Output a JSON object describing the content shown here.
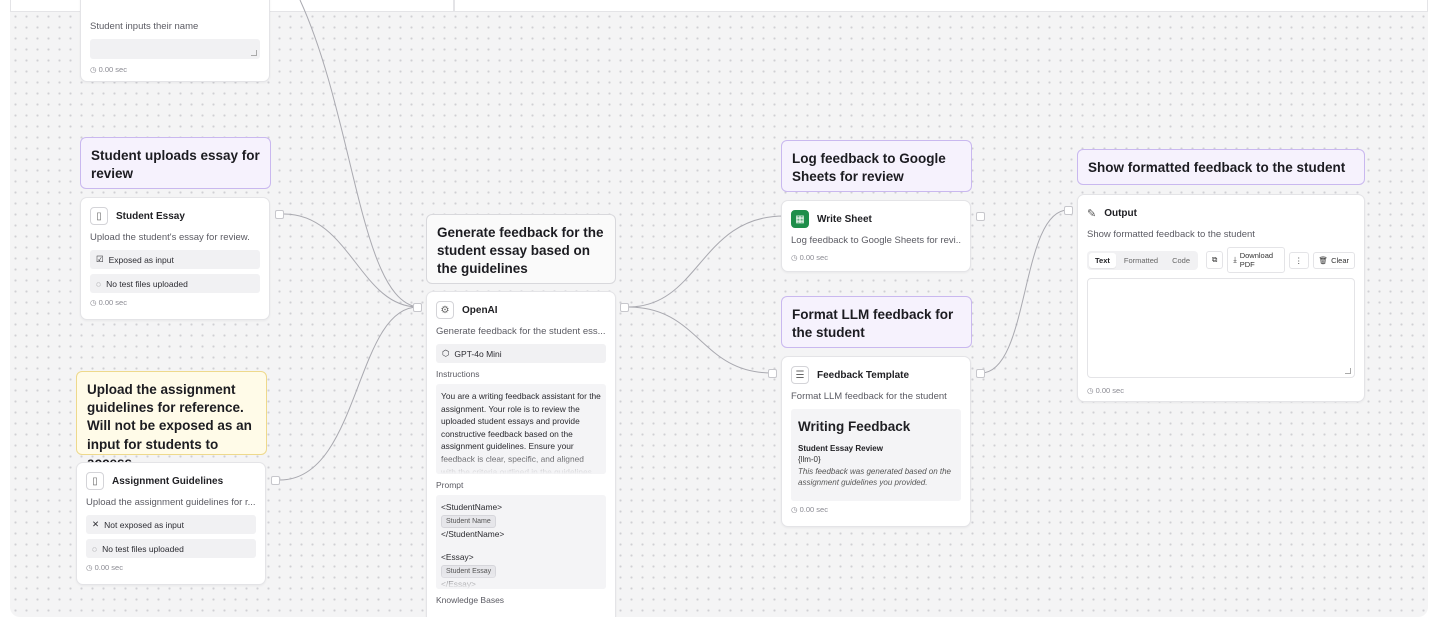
{
  "nodes": {
    "student_name": {
      "desc": "Student inputs their name",
      "time": "◷ 0.00 sec"
    },
    "student_essay": {
      "note": "Student uploads essay for review",
      "title": "Student Essay",
      "desc": "Upload the student's essay for review.",
      "exposed": "Exposed as input",
      "files": "No test files uploaded",
      "time": "◷ 0.00 sec"
    },
    "guidelines": {
      "note": "Upload the assignment guidelines for reference. Will not be exposed as an input for students to access",
      "title": "Assignment Guidelines",
      "desc": "Upload the assignment guidelines for r...",
      "exposed": "Not exposed as input",
      "files": "No test files uploaded",
      "time": "◷ 0.00 sec"
    },
    "openai": {
      "note": "Generate feedback for the student essay based on the guidelines",
      "title": "OpenAI",
      "desc": "Generate feedback for the student ess...",
      "model": "GPT-4o Mini",
      "instructions_label": "Instructions",
      "instructions": "You are a writing feedback assistant for the assignment. Your role is to review the uploaded student essays and provide constructive feedback based on the assignment guidelines. Ensure your feedback is clear, specific, and aligned with the criteria outlined in the guidelines.",
      "prompt_label": "Prompt",
      "prompt_name_open": "<StudentName>",
      "prompt_name_chip": "Student Name",
      "prompt_name_close": "</StudentName>",
      "prompt_essay_open": "<Essay>",
      "prompt_essay_chip": "Student Essay",
      "prompt_essay_close": "</Essay>",
      "kb_label": "Knowledge Bases"
    },
    "write_sheet": {
      "note": "Log feedback to Google Sheets for review",
      "title": "Write Sheet",
      "desc": "Log feedback to Google Sheets for revi...",
      "time": "◷ 0.00 sec"
    },
    "template": {
      "note": "Format LLM feedback for the student",
      "title": "Feedback Template",
      "desc": "Format LLM feedback for the student",
      "preview_heading": "Writing Feedback",
      "preview_sub": "Student Essay Review",
      "preview_var": "{llm-0}",
      "preview_italic": "This feedback was generated based on the assignment guidelines you provided.",
      "time": "◷ 0.00 sec"
    },
    "output": {
      "note": "Show formatted feedback to the student",
      "title": "Output",
      "desc": "Show formatted feedback to the student",
      "tabs": [
        "Text",
        "Formatted",
        "Code"
      ],
      "download": "Download PDF",
      "more": "⋮",
      "clear": "Clear",
      "time": "◷ 0.00 sec"
    }
  },
  "icons": {
    "file": "file-icon",
    "checkbox": "checkbox-icon",
    "dashed_circle": "dashed-circle-icon",
    "x": "x-icon",
    "openai": "openai-icon",
    "cube": "cube-icon",
    "sheets": "google-sheets-icon",
    "template": "template-icon",
    "pencil": "pencil-icon",
    "copy": "copy-icon",
    "download": "download-icon",
    "trash": "trash-icon"
  },
  "colors": {
    "note_purple_bg": "#f6f2fd",
    "note_purple_border": "#c9b8ef",
    "note_yellow_bg": "#fffbe8",
    "sheets_green": "#1e8e4a"
  }
}
